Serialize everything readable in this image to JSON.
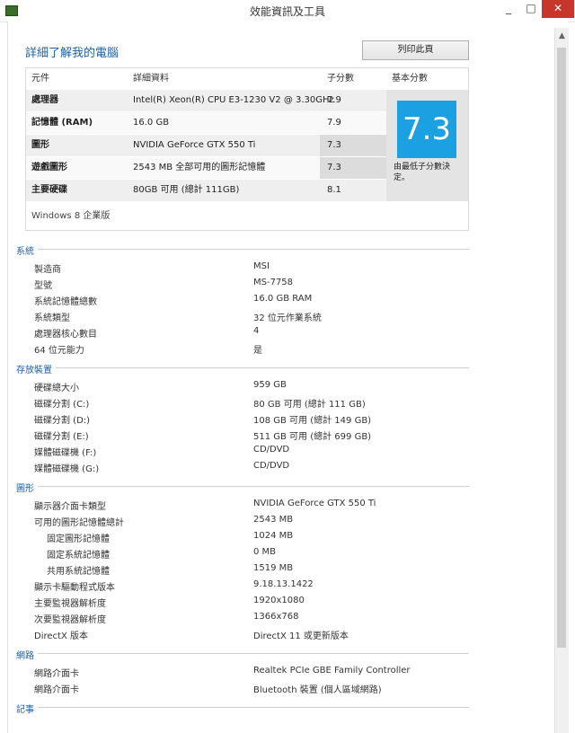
{
  "window": {
    "title": "效能資訊及工具",
    "minimize": "_",
    "maximize": "□",
    "close": "✕"
  },
  "page": {
    "title": "詳細了解我的電腦",
    "print_button": "列印此頁"
  },
  "summary": {
    "headers": {
      "component": "元件",
      "details": "詳細資料",
      "subscore": "子分數",
      "base_score": "基本分數"
    },
    "rows": [
      {
        "name": "處理器",
        "detail": "Intel(R) Xeon(R) CPU E3-1230 V2 @ 3.30GHz",
        "subscore": "7.9"
      },
      {
        "name": "記憶體 (RAM)",
        "detail": "16.0 GB",
        "subscore": "7.9"
      },
      {
        "name": "圖形",
        "detail": "NVIDIA GeForce GTX 550 Ti",
        "subscore": "7.3"
      },
      {
        "name": "遊戲圖形",
        "detail": "2543 MB 全部可用的圖形記憶體",
        "subscore": "7.3"
      },
      {
        "name": "主要硬碟",
        "detail": "80GB 可用 (總計 111GB)",
        "subscore": "8.1"
      }
    ],
    "base_score": "7.3",
    "base_note": "由最低子分數決定。",
    "edition": "Windows 8 企業版",
    "colors": {
      "score_tile": "#1ba1e2",
      "title_blue": "#1e5fa8"
    }
  },
  "sections": {
    "system": {
      "title": "系統",
      "items": [
        {
          "label": "製造商",
          "value": "MSI"
        },
        {
          "label": "型號",
          "value": "MS-7758"
        },
        {
          "label": "系統記憶體總數",
          "value": "16.0 GB RAM"
        },
        {
          "label": "系統類型",
          "value": "32 位元作業系統"
        },
        {
          "label": "處理器核心數目",
          "value": "4"
        },
        {
          "label": "64 位元能力",
          "value": "是"
        }
      ]
    },
    "storage": {
      "title": "存放裝置",
      "items": [
        {
          "label": "硬碟總大小",
          "value": "959 GB"
        },
        {
          "label": "磁碟分割 (C:)",
          "value": "80 GB 可用 (總計 111 GB)"
        },
        {
          "label": "磁碟分割 (D:)",
          "value": "108 GB 可用 (總計 149 GB)"
        },
        {
          "label": "磁碟分割 (E:)",
          "value": "511 GB 可用 (總計 699 GB)"
        },
        {
          "label": "媒體磁碟機 (F:)",
          "value": "CD/DVD"
        },
        {
          "label": "媒體磁碟機 (G:)",
          "value": "CD/DVD"
        }
      ]
    },
    "graphics": {
      "title": "圖形",
      "items": [
        {
          "label": "顯示器介面卡類型",
          "value": "NVIDIA GeForce GTX 550 Ti"
        },
        {
          "label": "可用的圖形記憶體總計",
          "value": "2543 MB"
        },
        {
          "label": "固定圖形記憶體",
          "value": "1024 MB"
        },
        {
          "label": "固定系統記憶體",
          "value": "0 MB"
        },
        {
          "label": "共用系統記憶體",
          "value": "1519 MB"
        },
        {
          "label": "顯示卡驅動程式版本",
          "value": "9.18.13.1422"
        },
        {
          "label": "主要監視器解析度",
          "value": "1920x1080"
        },
        {
          "label": "次要監視器解析度",
          "value": "1366x768"
        },
        {
          "label": "DirectX 版本",
          "value": "DirectX 11 或更新版本"
        }
      ]
    },
    "network": {
      "title": "網路",
      "items": [
        {
          "label": "網路介面卡",
          "value": "Realtek PCIe GBE Family Controller"
        },
        {
          "label": "網路介面卡",
          "value": "Bluetooth 裝置 (個人區域網路)"
        }
      ]
    },
    "notes": {
      "title": "記事"
    }
  }
}
